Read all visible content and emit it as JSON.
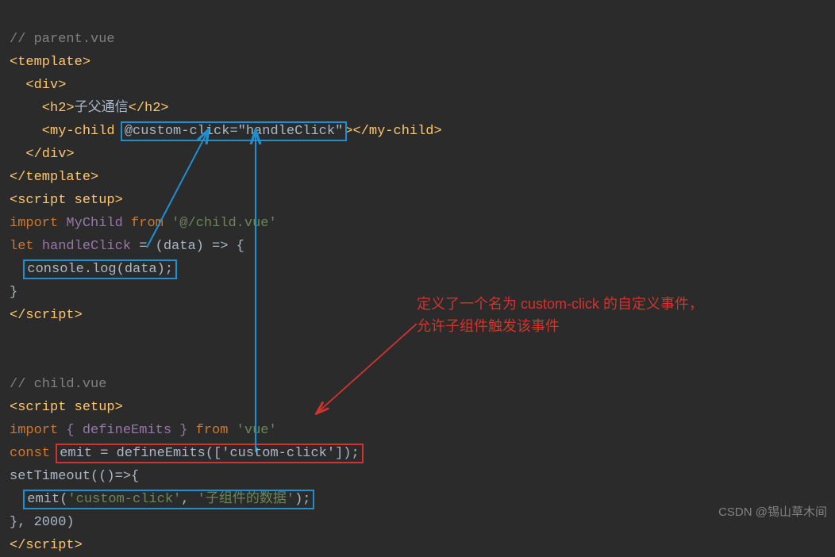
{
  "code": {
    "parent_comment": "// parent.vue",
    "tpl_open": "<template>",
    "div_open": "  <div>",
    "h2_open": "    <h2>",
    "h2_text": "子父通信",
    "h2_close": "</h2>",
    "mychild_open": "    <my-child ",
    "mychild_attr": "@custom-click=\"handleClick\"",
    "mychild_close": "></my-child>",
    "div_close": "  </div>",
    "tpl_close": "</template>",
    "script_open": "<script setup>",
    "import1_kw": "import ",
    "import1_name": "MyChild ",
    "import1_from": "from ",
    "import1_path": "'@/child.vue'",
    "let_kw": "let ",
    "let_name": "handleClick ",
    "let_eq": "= (data) => {",
    "console_log": "console.log(data);",
    "brace_close": "}",
    "script_close_tag": "</script>",
    "child_comment": "// child.vue",
    "script_open2": "<script setup>",
    "import2_kw": "import ",
    "import2_braces": "{ defineEmits } ",
    "import2_from": "from ",
    "import2_path": "'vue'",
    "const_kw": "const ",
    "emit_def": "emit = defineEmits(['custom-click']);",
    "settimeout": "setTimeout(()=>{",
    "emit_call_pre": "emit(",
    "emit_call_s1": "'custom-click'",
    "emit_call_mid": ", ",
    "emit_call_s2": "'子组件的数据'",
    "emit_call_post": ");",
    "settimeout_close": "}, 2000)",
    "script_close_tag2": "</script>"
  },
  "annotation": "定义了一个名为 custom-click 的自定义事件，\n允许子组件触发该事件",
  "watermark": "CSDN @锡山草木间"
}
